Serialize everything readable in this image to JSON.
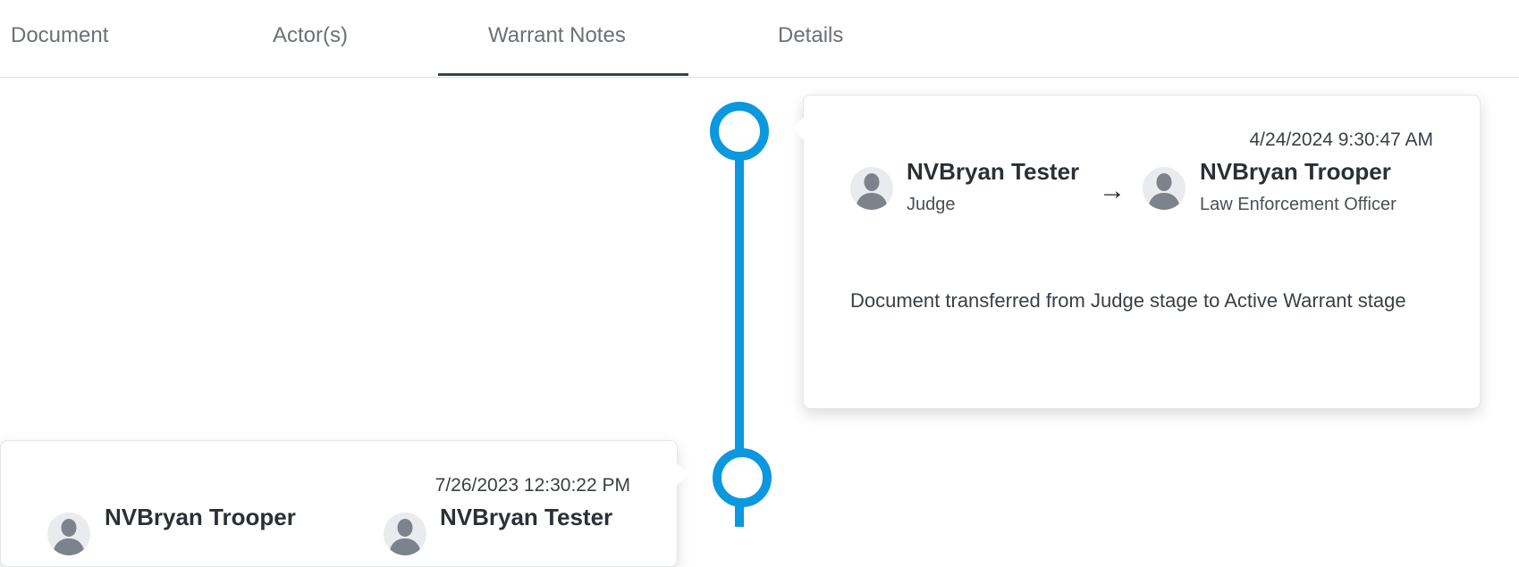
{
  "tabs": [
    {
      "label": "Document"
    },
    {
      "label": "Actor(s)"
    },
    {
      "label": "Warrant Notes",
      "active": true
    },
    {
      "label": "Details"
    }
  ],
  "colors": {
    "timeline": "#0b98df",
    "active_tab_underline": "#3a4150"
  },
  "timeline": [
    {
      "timestamp": "4/24/2024 9:30:47 AM",
      "from": {
        "name": "NVBryan Tester",
        "role": "Judge",
        "icon": "user-avatar-icon"
      },
      "to": {
        "name": "NVBryan Trooper",
        "role": "Law Enforcement Officer",
        "icon": "user-avatar-icon"
      },
      "arrow_icon": "arrow-right-icon",
      "note": "Document transferred from Judge stage to Active Warrant stage"
    },
    {
      "timestamp": "7/26/2023 12:30:22 PM",
      "from": {
        "name": "NVBryan Trooper",
        "icon": "user-avatar-icon"
      },
      "to": {
        "name": "NVBryan Tester",
        "icon": "user-avatar-icon"
      }
    }
  ]
}
